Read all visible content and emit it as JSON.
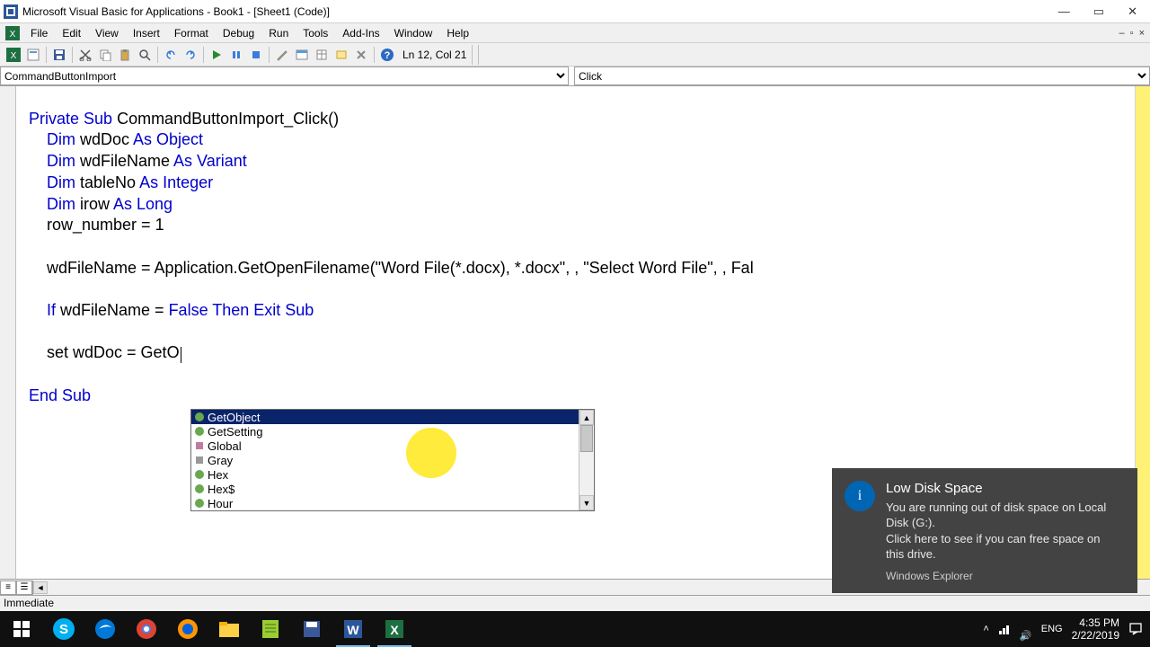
{
  "title": "Microsoft Visual Basic for Applications - Book1 - [Sheet1 (Code)]",
  "menus": [
    "File",
    "Edit",
    "View",
    "Insert",
    "Format",
    "Debug",
    "Run",
    "Tools",
    "Add-Ins",
    "Window",
    "Help"
  ],
  "cursor_pos": "Ln 12, Col 21",
  "object_box": "CommandButtonImport",
  "proc_box": "Click",
  "immediate_label": "Immediate",
  "code": {
    "l1a": "Private Sub",
    "l1b": " CommandButtonImport_Click()",
    "l2a": "    Dim",
    "l2b": " wdDoc ",
    "l2c": "As Object",
    "l3a": "    Dim",
    "l3b": " wdFileName ",
    "l3c": "As Variant",
    "l4a": "    Dim",
    "l4b": " tableNo ",
    "l4c": "As Integer",
    "l5a": "    Dim",
    "l5b": " irow ",
    "l5c": "As Long",
    "l6": "    row_number = 1",
    "l7": "",
    "l8": "    wdFileName = Application.GetOpenFilename(\"Word File(*.docx), *.docx\", , \"Select Word File\", , Fal",
    "l9": "",
    "l10a": "    If",
    "l10b": " wdFileName = ",
    "l10c": "False Then Exit Sub",
    "l11": "",
    "l12": "    set wdDoc = GetO",
    "l13": "",
    "l14": "End Sub"
  },
  "intelli_items": [
    "GetObject",
    "GetSetting",
    "Global",
    "Gray",
    "Hex",
    "Hex$",
    "Hour"
  ],
  "toast": {
    "title": "Low Disk Space",
    "body": "You are running out of disk space on Local Disk (G:).\nClick here to see if you can free space on this drive.",
    "source": "Windows Explorer"
  },
  "tray": {
    "lang": "ENG",
    "time": "4:35 PM",
    "date": "2/22/2019",
    "net": "↑"
  }
}
